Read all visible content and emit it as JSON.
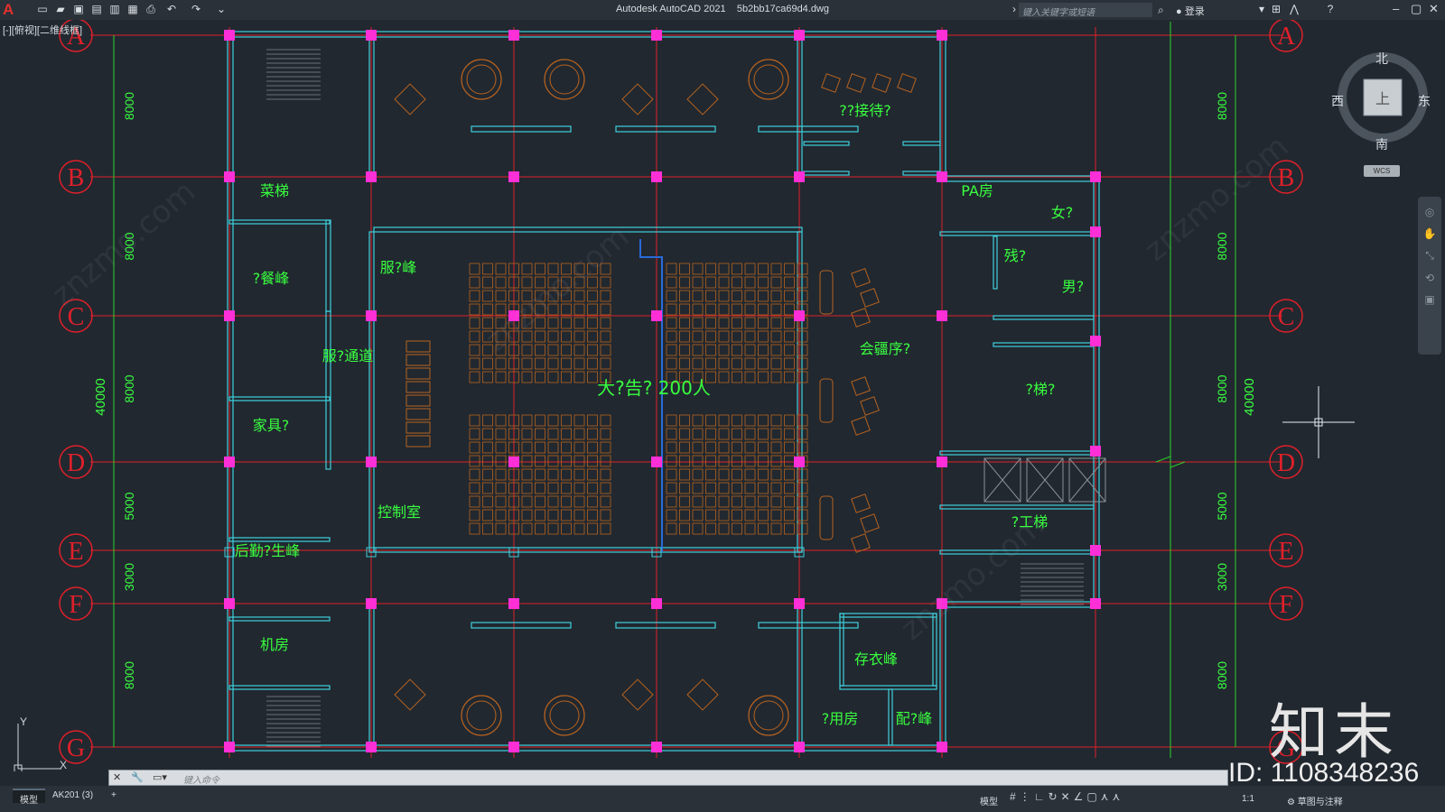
{
  "app": {
    "title": "Autodesk AutoCAD 2021",
    "filename": "5b2bb17ca69d4.dwg",
    "search_placeholder": "键入关键字或短语",
    "login": "登录",
    "view_label": "[-][俯视][二维线框]",
    "logo": "A"
  },
  "viewcube": {
    "north": "北",
    "south": "南",
    "east": "东",
    "west": "西",
    "top": "上",
    "wcs": "WCS"
  },
  "grid": {
    "rows": [
      "A",
      "B",
      "C",
      "D",
      "E",
      "F",
      "G"
    ],
    "spacings": [
      "8000",
      "8000",
      "8000",
      "5000",
      "3000",
      "8000"
    ],
    "total": "40000"
  },
  "rooms": [
    {
      "label": "??接待?"
    },
    {
      "label": "菜梯"
    },
    {
      "label": "?餐峰"
    },
    {
      "label": "服?峰"
    },
    {
      "label": "服?通道"
    },
    {
      "label": "家具?"
    },
    {
      "label": "控制室"
    },
    {
      "label": "后勤?生峰"
    },
    {
      "label": "机房"
    },
    {
      "label": "大?告?  200人"
    },
    {
      "label": "会疆序?"
    },
    {
      "label": "PA房"
    },
    {
      "label": "女?"
    },
    {
      "label": "残?"
    },
    {
      "label": "男?"
    },
    {
      "label": "?梯?"
    },
    {
      "label": "?工梯"
    },
    {
      "label": "存衣峰"
    },
    {
      "label": "?用房"
    },
    {
      "label": "配?峰"
    }
  ],
  "ucs": {
    "x": "X",
    "y": "Y"
  },
  "command": {
    "placeholder": "键入命令"
  },
  "tabs": [
    {
      "label": "模型"
    },
    {
      "label": "AK201 (3)"
    },
    {
      "label": "+"
    }
  ],
  "statusbar": {
    "model": "模型",
    "scale": "1:1",
    "annotation": "草图与注释"
  },
  "watermark": {
    "brand": "知末",
    "id": "ID: 1108348236",
    "text": "znzmo.com"
  },
  "colors": {
    "background": "#212830",
    "gridline": "#e0202a",
    "wall": "#3fd0dc",
    "column": "#ff2fd7",
    "text": "#39ff3f",
    "furniture": "#b8631f"
  }
}
